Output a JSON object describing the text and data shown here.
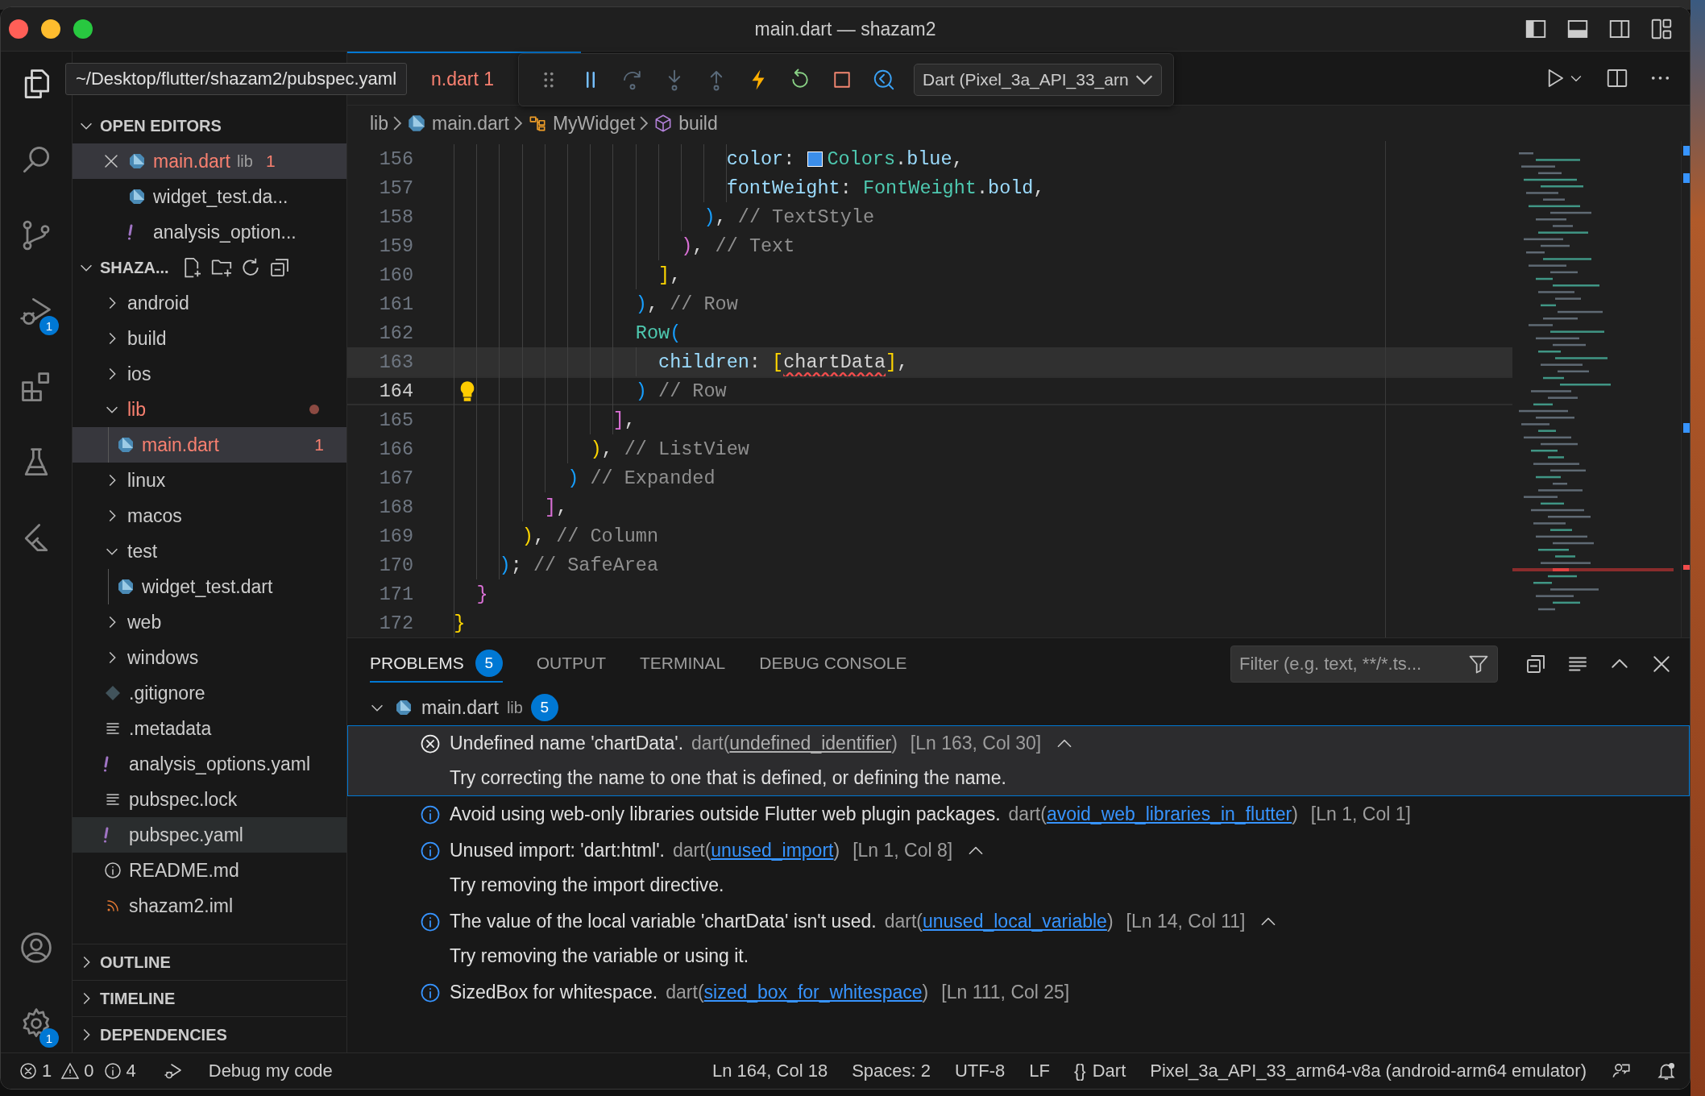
{
  "window": {
    "title": "main.dart — shazam2"
  },
  "tooltip": "~/Desktop/flutter/shazam2/pubspec.yaml",
  "activity_bar": [
    {
      "kind": "explorer",
      "selected": true
    },
    {
      "kind": "search",
      "selected": false
    },
    {
      "kind": "source-control",
      "selected": false
    },
    {
      "kind": "debug",
      "selected": false,
      "badge": "1"
    },
    {
      "kind": "extensions",
      "selected": false
    },
    {
      "kind": "testing",
      "selected": false
    },
    {
      "kind": "flutter",
      "selected": false
    }
  ],
  "activity_bar_bottom": [
    {
      "kind": "account"
    },
    {
      "kind": "settings",
      "badge": "1"
    }
  ],
  "sidebar": {
    "open_editors": {
      "title": "OPEN EDITORS",
      "expanded": true,
      "items": [
        {
          "name": "main.dart",
          "description": "lib",
          "badge": "1",
          "kind": "dart",
          "selected": true,
          "error": true
        },
        {
          "name": "widget_test.da...",
          "kind": "dart",
          "selected": false,
          "error": false
        },
        {
          "name": "analysis_option...",
          "kind": "yaml",
          "selected": false,
          "error": false
        }
      ]
    },
    "explorer": {
      "title": "SHAZA...",
      "expanded": true,
      "items": [
        {
          "name": "android",
          "kind": "folder",
          "expanded": false,
          "selected": false,
          "hovered": false,
          "error": false
        },
        {
          "name": "build",
          "kind": "folder",
          "expanded": false,
          "selected": false,
          "hovered": false,
          "error": false
        },
        {
          "name": "ios",
          "kind": "folder",
          "expanded": false,
          "selected": false,
          "hovered": false,
          "error": false
        },
        {
          "name": "lib",
          "kind": "folder",
          "expanded": true,
          "selected": false,
          "hovered": false,
          "error": true,
          "children": [
            {
              "name": "main.dart",
              "kind": "dart",
              "selected": true,
              "hovered": false,
              "error": true,
              "badge": "1"
            }
          ]
        },
        {
          "name": "linux",
          "kind": "folder",
          "expanded": false,
          "selected": false,
          "hovered": false,
          "error": false
        },
        {
          "name": "macos",
          "kind": "folder",
          "expanded": false,
          "selected": false,
          "hovered": false,
          "error": false
        },
        {
          "name": "test",
          "kind": "folder",
          "expanded": true,
          "selected": false,
          "hovered": false,
          "error": false,
          "children": [
            {
              "name": "widget_test.dart",
              "kind": "dart",
              "selected": false,
              "hovered": false,
              "error": false
            }
          ]
        },
        {
          "name": "web",
          "kind": "folder",
          "expanded": false,
          "selected": false,
          "hovered": false,
          "error": false
        },
        {
          "name": "windows",
          "kind": "folder",
          "expanded": false,
          "selected": false,
          "hovered": false,
          "error": false
        },
        {
          "name": ".gitignore",
          "kind": "git",
          "selected": false,
          "hovered": false,
          "error": false
        },
        {
          "name": ".metadata",
          "kind": "text",
          "selected": false,
          "hovered": false,
          "error": false
        },
        {
          "name": "analysis_options.yaml",
          "kind": "yaml",
          "selected": false,
          "hovered": false,
          "error": false
        },
        {
          "name": "pubspec.lock",
          "kind": "text",
          "selected": false,
          "hovered": false,
          "error": false
        },
        {
          "name": "pubspec.yaml",
          "kind": "yaml",
          "selected": false,
          "hovered": true,
          "error": false
        },
        {
          "name": "README.md",
          "kind": "info",
          "selected": false,
          "hovered": false,
          "error": false
        },
        {
          "name": "shazam2.iml",
          "kind": "feed",
          "selected": false,
          "hovered": false,
          "error": false
        }
      ]
    },
    "sections": [
      {
        "title": "OUTLINE",
        "expanded": false
      },
      {
        "title": "TIMELINE",
        "expanded": false
      },
      {
        "title": "DEPENDENCIES",
        "expanded": false
      }
    ]
  },
  "editor_tabs": [
    {
      "label": "n.dart",
      "badge": "1",
      "selected": true,
      "error": true
    }
  ],
  "debug_toolbar": {
    "buttons": [
      {
        "kind": "grip",
        "disabled": false
      },
      {
        "kind": "pause",
        "disabled": false
      },
      {
        "kind": "step-over",
        "disabled": true
      },
      {
        "kind": "step-into",
        "disabled": true
      },
      {
        "kind": "step-out",
        "disabled": true
      },
      {
        "kind": "hot-reload",
        "disabled": false
      },
      {
        "kind": "restart",
        "disabled": false
      },
      {
        "kind": "stop",
        "disabled": false
      },
      {
        "kind": "devtools",
        "disabled": false
      }
    ],
    "target": "Dart (Pixel_3a_API_33_arn"
  },
  "editor_actions": [
    {
      "kind": "run"
    },
    {
      "kind": "split"
    },
    {
      "kind": "more"
    }
  ],
  "breadcrumbs": [
    {
      "label": "lib",
      "kind": "folder"
    },
    {
      "label": "main.dart",
      "kind": "dart"
    },
    {
      "label": "MyWidget",
      "kind": "class"
    },
    {
      "label": "build",
      "kind": "method"
    }
  ],
  "editor": {
    "lines": [
      {
        "number": "156",
        "current": false,
        "highlighted": false,
        "lightbulb": false,
        "tokens": [
          {
            "text": "                          color",
            "kind": "property"
          },
          {
            "text": ": ",
            "kind": "plain"
          },
          {
            "kind": "swatch",
            "color": "#3b8eea"
          },
          {
            "text": "Colors",
            "kind": "type"
          },
          {
            "text": ".",
            "kind": "plain"
          },
          {
            "text": "blue",
            "kind": "property"
          },
          {
            "text": ",",
            "kind": "plain"
          }
        ]
      },
      {
        "number": "157",
        "current": false,
        "highlighted": false,
        "lightbulb": false,
        "tokens": [
          {
            "text": "                          fontWeight",
            "kind": "property"
          },
          {
            "text": ": ",
            "kind": "plain"
          },
          {
            "text": "FontWeight",
            "kind": "type"
          },
          {
            "text": ".",
            "kind": "plain"
          },
          {
            "text": "bold",
            "kind": "property"
          },
          {
            "text": ",",
            "kind": "plain"
          }
        ]
      },
      {
        "number": "158",
        "current": false,
        "highlighted": false,
        "lightbulb": false,
        "tokens": [
          {
            "text": "                        )",
            "kind": "bracket3"
          },
          {
            "text": ", ",
            "kind": "plain"
          },
          {
            "text": "// TextStyle",
            "kind": "comment"
          }
        ]
      },
      {
        "number": "159",
        "current": false,
        "highlighted": false,
        "lightbulb": false,
        "tokens": [
          {
            "text": "                      )",
            "kind": "bracket2"
          },
          {
            "text": ", ",
            "kind": "plain"
          },
          {
            "text": "// Text",
            "kind": "comment"
          }
        ]
      },
      {
        "number": "160",
        "current": false,
        "highlighted": false,
        "lightbulb": false,
        "tokens": [
          {
            "text": "                    ]",
            "kind": "bracket1"
          },
          {
            "text": ",",
            "kind": "plain"
          }
        ]
      },
      {
        "number": "161",
        "current": false,
        "highlighted": false,
        "lightbulb": false,
        "tokens": [
          {
            "text": "                  )",
            "kind": "bracket3"
          },
          {
            "text": ", ",
            "kind": "plain"
          },
          {
            "text": "// Row",
            "kind": "comment"
          }
        ]
      },
      {
        "number": "162",
        "current": false,
        "highlighted": false,
        "lightbulb": false,
        "tokens": [
          {
            "text": "                  Row",
            "kind": "type"
          },
          {
            "text": "(",
            "kind": "bracket3"
          }
        ]
      },
      {
        "number": "163",
        "current": false,
        "highlighted": true,
        "lightbulb": false,
        "tokens": [
          {
            "text": "                    children",
            "kind": "property"
          },
          {
            "text": ": ",
            "kind": "plain"
          },
          {
            "text": "[",
            "kind": "bracket1"
          },
          {
            "text": "chartData",
            "kind": "error"
          },
          {
            "text": "]",
            "kind": "bracket1"
          },
          {
            "text": ",",
            "kind": "plain"
          }
        ]
      },
      {
        "number": "164",
        "current": true,
        "highlighted": false,
        "lightbulb": true,
        "tokens": [
          {
            "text": "                  )",
            "kind": "bracket3"
          },
          {
            "text": " // Row",
            "kind": "comment"
          }
        ]
      },
      {
        "number": "165",
        "current": false,
        "highlighted": false,
        "lightbulb": false,
        "tokens": [
          {
            "text": "                ]",
            "kind": "bracket2"
          },
          {
            "text": ",",
            "kind": "plain"
          }
        ]
      },
      {
        "number": "166",
        "current": false,
        "highlighted": false,
        "lightbulb": false,
        "tokens": [
          {
            "text": "              )",
            "kind": "bracket1"
          },
          {
            "text": ", ",
            "kind": "plain"
          },
          {
            "text": "// ListView",
            "kind": "comment"
          }
        ]
      },
      {
        "number": "167",
        "current": false,
        "highlighted": false,
        "lightbulb": false,
        "tokens": [
          {
            "text": "            )",
            "kind": "bracket3"
          },
          {
            "text": " // Expanded",
            "kind": "comment"
          }
        ]
      },
      {
        "number": "168",
        "current": false,
        "highlighted": false,
        "lightbulb": false,
        "tokens": [
          {
            "text": "          ]",
            "kind": "bracket2"
          },
          {
            "text": ",",
            "kind": "plain"
          }
        ]
      },
      {
        "number": "169",
        "current": false,
        "highlighted": false,
        "lightbulb": false,
        "tokens": [
          {
            "text": "        )",
            "kind": "bracket1"
          },
          {
            "text": ", ",
            "kind": "plain"
          },
          {
            "text": "// Column",
            "kind": "comment"
          }
        ]
      },
      {
        "number": "170",
        "current": false,
        "highlighted": false,
        "lightbulb": false,
        "tokens": [
          {
            "text": "      )",
            "kind": "bracket3"
          },
          {
            "text": "; ",
            "kind": "plain"
          },
          {
            "text": "// SafeArea",
            "kind": "comment"
          }
        ]
      },
      {
        "number": "171",
        "current": false,
        "highlighted": false,
        "lightbulb": false,
        "tokens": [
          {
            "text": "    }",
            "kind": "bracket2"
          }
        ]
      },
      {
        "number": "172",
        "current": false,
        "highlighted": false,
        "lightbulb": false,
        "tokens": [
          {
            "text": "  }",
            "kind": "bracket1"
          }
        ]
      }
    ]
  },
  "panel": {
    "tabs": [
      {
        "label": "PROBLEMS",
        "badge": "5",
        "selected": true
      },
      {
        "label": "OUTPUT",
        "selected": false
      },
      {
        "label": "TERMINAL",
        "selected": false
      },
      {
        "label": "DEBUG CONSOLE",
        "selected": false
      }
    ],
    "filter": {
      "placeholder": "Filter (e.g. text, **/*.ts..."
    },
    "actions": [
      {
        "kind": "filter"
      },
      {
        "kind": "collapse"
      },
      {
        "kind": "wrap"
      },
      {
        "kind": "maximize"
      },
      {
        "kind": "close"
      }
    ],
    "problems": {
      "file": "main.dart",
      "folder": "lib",
      "count": "5",
      "expanded": true,
      "items": [
        {
          "kind": "error",
          "message": "Undefined name 'chartData'.",
          "source": "dart(",
          "code": "undefined_identifier",
          "source_end": ")",
          "location": "[Ln 163, Col 30]",
          "detail": "Try correcting the name to one that is defined, or defining the name.",
          "selected": true
        },
        {
          "kind": "info",
          "message": "Avoid using web-only libraries outside Flutter web plugin packages.",
          "source": "dart(",
          "code": "avoid_web_libraries_in_flutter",
          "source_end": ")",
          "location": "[Ln 1, Col 1]",
          "selected": false
        },
        {
          "kind": "info",
          "message": "Unused import: 'dart:html'.",
          "source": "dart(",
          "code": "unused_import",
          "source_end": ")",
          "location": "[Ln 1, Col 8]",
          "detail": "Try removing the import directive.",
          "selected": false
        },
        {
          "kind": "info",
          "message": "The value of the local variable 'chartData' isn't used.",
          "source": "dart(",
          "code": "unused_local_variable",
          "source_end": ")",
          "location": "[Ln 14, Col 11]",
          "detail": "Try removing the variable or using it.",
          "selected": false
        },
        {
          "kind": "info",
          "message": "SizedBox for whitespace.",
          "source": "dart(",
          "code": "sized_box_for_whitespace",
          "source_end": ")",
          "location": "[Ln 111, Col 25]",
          "selected": false
        }
      ]
    }
  },
  "status_bar": {
    "errors": "1",
    "warnings": "0",
    "infos": "4",
    "debug_label": "Debug my code",
    "right": [
      {
        "text": "Ln 164, Col 18"
      },
      {
        "text": "Spaces: 2"
      },
      {
        "text": "UTF-8"
      },
      {
        "text": "LF"
      },
      {
        "icon": "{}",
        "text": "Dart"
      },
      {
        "text": "Pixel_3a_API_33_arm64-v8a (android-arm64 emulator)"
      }
    ]
  }
}
